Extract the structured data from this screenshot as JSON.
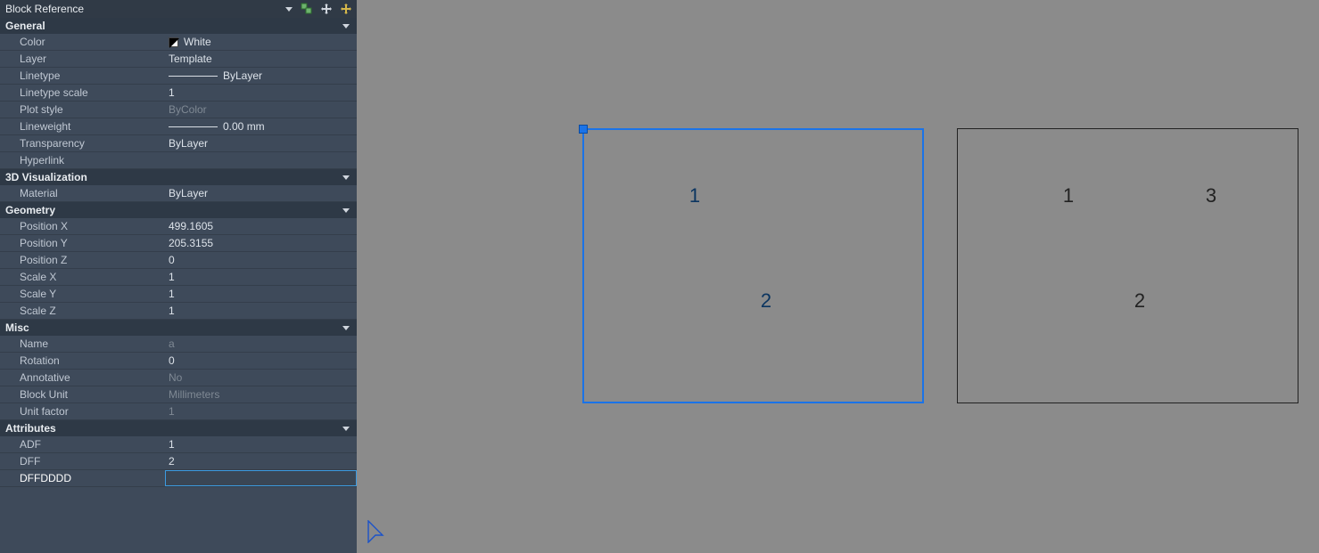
{
  "panel_title": "Block Reference",
  "sections": {
    "general": {
      "header": "General",
      "color_label": "Color",
      "color_value": "White",
      "layer_label": "Layer",
      "layer_value": "Template",
      "linetype_label": "Linetype",
      "linetype_value": "ByLayer",
      "ltscale_label": "Linetype scale",
      "ltscale_value": "1",
      "plotstyle_label": "Plot style",
      "plotstyle_value": "ByColor",
      "lineweight_label": "Lineweight",
      "lineweight_value": "0.00 mm",
      "transparency_label": "Transparency",
      "transparency_value": "ByLayer",
      "hyperlink_label": "Hyperlink",
      "hyperlink_value": ""
    },
    "vis3d": {
      "header": "3D Visualization",
      "material_label": "Material",
      "material_value": "ByLayer"
    },
    "geometry": {
      "header": "Geometry",
      "posx_label": "Position X",
      "posx_value": "499.1605",
      "posy_label": "Position Y",
      "posy_value": "205.3155",
      "posz_label": "Position Z",
      "posz_value": "0",
      "sx_label": "Scale X",
      "sx_value": "1",
      "sy_label": "Scale Y",
      "sy_value": "1",
      "sz_label": "Scale Z",
      "sz_value": "1"
    },
    "misc": {
      "header": "Misc",
      "name_label": "Name",
      "name_value": "a",
      "rotation_label": "Rotation",
      "rotation_value": "0",
      "annotative_label": "Annotative",
      "annotative_value": "No",
      "blockunit_label": "Block Unit",
      "blockunit_value": "Millimeters",
      "unitfactor_label": "Unit factor",
      "unitfactor_value": "1"
    },
    "attributes": {
      "header": "Attributes",
      "adf_label": "ADF",
      "adf_value": "1",
      "dff_label": "DFF",
      "dff_value": "2",
      "dffdddd_label": "DFFDDDD",
      "dffdddd_value": ""
    }
  },
  "canvas": {
    "block1_numbers": {
      "n1": "1",
      "n2": "2"
    },
    "block2_numbers": {
      "n1": "1",
      "n2": "2",
      "n3": "3"
    }
  }
}
